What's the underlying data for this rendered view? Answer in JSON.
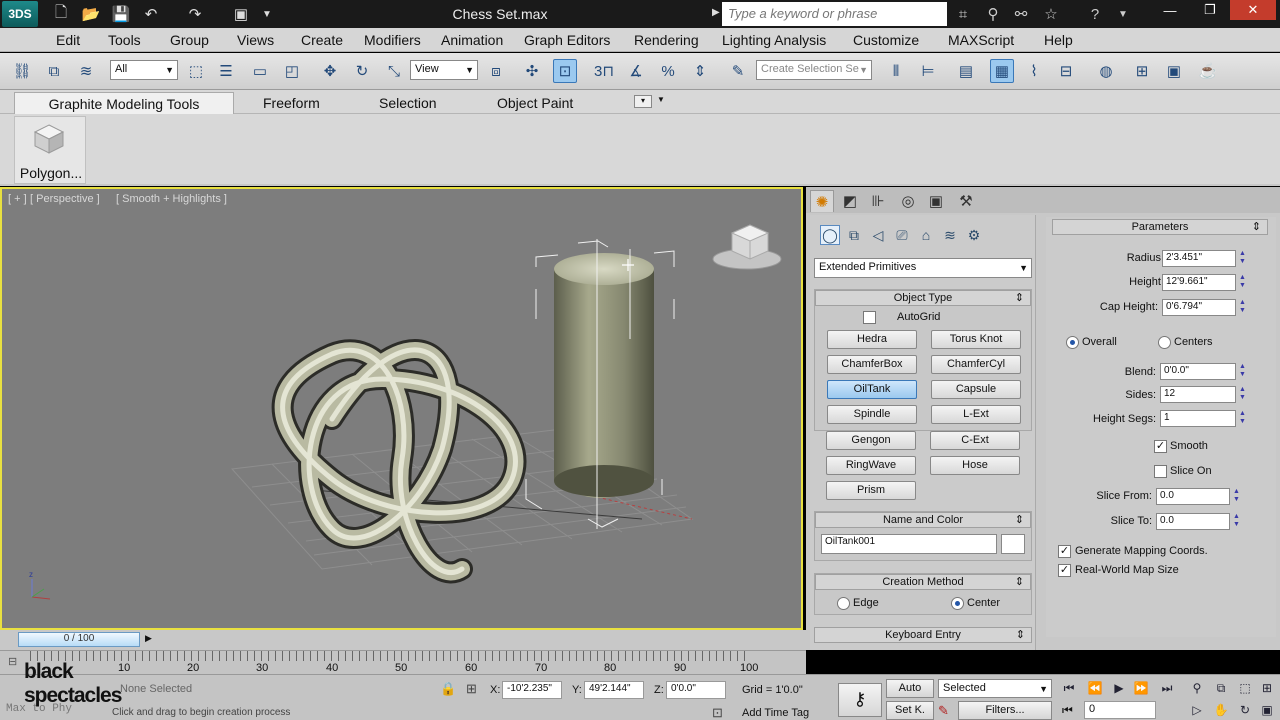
{
  "app": {
    "logo_text": "3DS",
    "title": "Chess Set.max",
    "search_placeholder": "Type a keyword or phrase"
  },
  "menu": [
    "Edit",
    "Tools",
    "Group",
    "Views",
    "Create",
    "Modifiers",
    "Animation",
    "Graph Editors",
    "Rendering",
    "Lighting Analysis",
    "Customize",
    "MAXScript",
    "Help"
  ],
  "toolbar": {
    "selection_filter": "All",
    "reference_coord": "View",
    "named_selection_placeholder": "Create Selection Se",
    "snap_label": "3",
    "percent_snap": "%"
  },
  "ribbon": {
    "tabs": [
      "Graphite Modeling Tools",
      "Freeform",
      "Selection",
      "Object Paint"
    ],
    "panel_label": "Polygon..."
  },
  "viewport": {
    "labels": [
      "[ + ]",
      "[ Perspective ]",
      "[ Smooth + Highlights ]"
    ]
  },
  "command_panel": {
    "category": "Extended Primitives",
    "object_type": {
      "title": "Object Type",
      "autogrid": "AutoGrid",
      "buttons": [
        "Hedra",
        "Torus Knot",
        "ChamferBox",
        "ChamferCyl",
        "OilTank",
        "Capsule",
        "Spindle",
        "L-Ext",
        "Gengon",
        "C-Ext",
        "RingWave",
        "Hose",
        "Prism"
      ],
      "active": "OilTank"
    },
    "name_color": {
      "title": "Name and Color",
      "name": "OilTank001"
    },
    "creation_method": {
      "title": "Creation Method",
      "edge": "Edge",
      "center": "Center",
      "selected": "Center"
    },
    "keyboard_entry": "Keyboard Entry",
    "parameters": {
      "title": "Parameters",
      "radius_label": "Radius:",
      "radius": "2'3.451\"",
      "height_label": "Height:",
      "height": "12'9.661\"",
      "cap_label": "Cap Height:",
      "cap": "0'6.794\"",
      "overall": "Overall",
      "centers": "Centers",
      "mode_selected": "Overall",
      "blend_label": "Blend:",
      "blend": "0'0.0\"",
      "sides_label": "Sides:",
      "sides": "12",
      "hsegs_label": "Height Segs:",
      "hsegs": "1",
      "smooth": "Smooth",
      "smooth_checked": true,
      "slice_on": "Slice On",
      "slice_checked": false,
      "slice_from_label": "Slice From:",
      "slice_from": "0.0",
      "slice_to_label": "Slice To:",
      "slice_to": "0.0",
      "gen_map": "Generate Mapping Coords.",
      "gen_map_checked": true,
      "real_world": "Real-World Map Size",
      "real_world_checked": true
    }
  },
  "timeline": {
    "frame": "0 / 100",
    "ticks": [
      "10",
      "20",
      "30",
      "40",
      "50",
      "60",
      "70",
      "80",
      "90",
      "100"
    ]
  },
  "status": {
    "selection": "None Selected",
    "prompt": "Click and drag to begin creation process",
    "script_hint": "Max to Phy",
    "x_label": "X:",
    "x": "-10'2.235\"",
    "y_label": "Y:",
    "y": "49'2.144\"",
    "z_label": "Z:",
    "z": "0'0.0\"",
    "grid": "Grid = 1'0.0\"",
    "add_time_tag": "Add Time Tag",
    "auto": "Auto",
    "set_key": "Set K.",
    "key_filter": "Selected",
    "filters": "Filters...",
    "current_frame": "0"
  },
  "watermark": {
    "line1": "black",
    "line2": "spectacles"
  },
  "colors": {
    "viewport_border": "#e8e040",
    "active_button": "#9bc9ef",
    "viewport_bg": "#7d7d7d"
  }
}
